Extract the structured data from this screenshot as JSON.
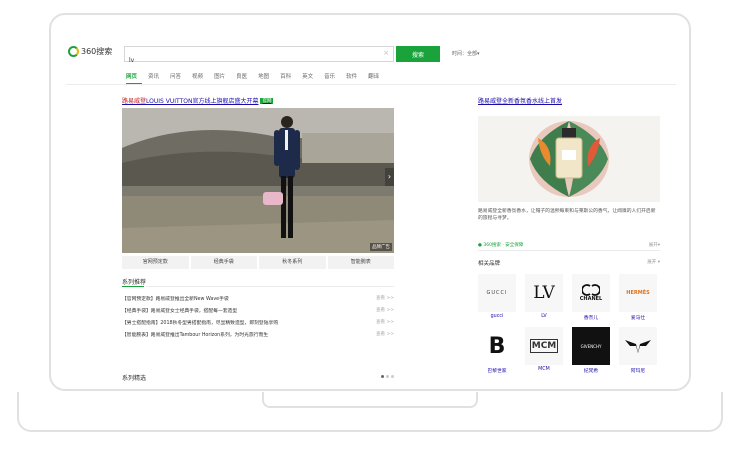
{
  "search": {
    "logo_text": "360搜索",
    "query": "lv",
    "clear": "×",
    "button": "搜索",
    "time_filter": "时间：全部▾"
  },
  "tabs": [
    "网页",
    "资讯",
    "问答",
    "视频",
    "图片",
    "良医",
    "地图",
    "百科",
    "英文",
    "音乐",
    "软件",
    "翻译"
  ],
  "ad": {
    "brand": "路易威登",
    "title_rest": "LOUIS VUITTON官方线上旗舰店盛大开幕",
    "badge": "官网",
    "image_tag": "品牌广告",
    "subtabs": [
      "官网预定款",
      "经典手袋",
      "秋冬系列",
      "智能腕表"
    ]
  },
  "series": {
    "title": "系列推荐",
    "items": [
      {
        "text": "【官网预定款】路易威登推出全新New Wave手袋",
        "more": "查看 >>"
      },
      {
        "text": "【经典手袋】路易威登女士经典手袋，搭配每一套造型",
        "more": "查看 >>"
      },
      {
        "text": "【男士搭配指南】2018秋冬型男搭配指南，尽显精致造型，即刻登陆享购",
        "more": "查看 >>"
      },
      {
        "text": "【智能腕表】路易威登推出Tambour Horizon系列，为时光旅行而生",
        "more": "查看 >>"
      }
    ],
    "section2": "系列精选"
  },
  "right": {
    "title": "路易威登全新香氛香水线上首发",
    "desc": "路易威登全新香氛香水，让帽子的温熙每束和与莱斯公的香气，让闻嗅的人们开启新的旅程与寻梦。",
    "source": "● 360搜索 · 安全保障",
    "source_expand": "展开▾",
    "brands_title": "相关品牌",
    "brands_expand": "展开 ▾",
    "brands": [
      {
        "name": "gucci",
        "logo": "GUCCI",
        "icon": "gucci-logo"
      },
      {
        "name": "LV",
        "logo": "LV",
        "icon": "lv-logo"
      },
      {
        "name": "香奈儿",
        "logo": "CHANEL",
        "icon": "chanel-logo"
      },
      {
        "name": "爱马仕",
        "logo": "HERMÈS",
        "icon": "hermes-logo"
      },
      {
        "name": "巴黎世家",
        "logo": "B",
        "icon": "balenciaga-logo"
      },
      {
        "name": "MCM",
        "logo": "MCM",
        "icon": "mcm-logo"
      },
      {
        "name": "纪梵希",
        "logo": "GIVENCHY",
        "icon": "givenchy-logo"
      },
      {
        "name": "阿玛尼",
        "logo": "",
        "icon": "armani-eagle-logo"
      }
    ]
  },
  "colors": {
    "accent": "#1aa33b",
    "link": "#1a0dab",
    "brand_red": "#c81d1d"
  }
}
